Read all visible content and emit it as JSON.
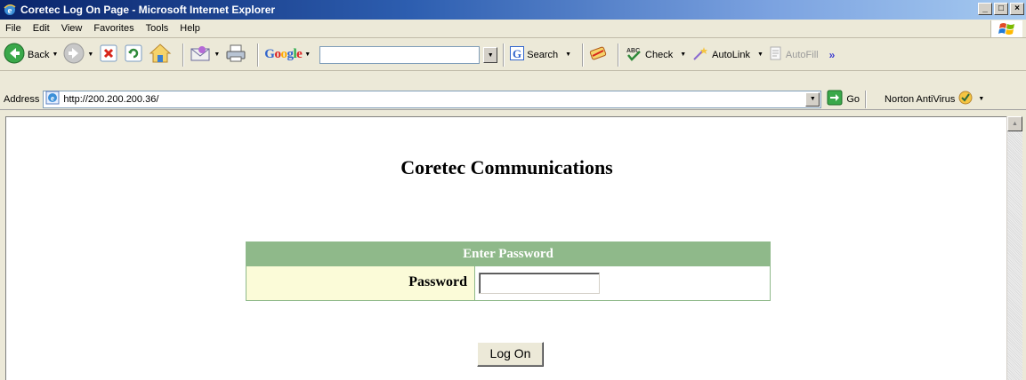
{
  "window": {
    "title": "Coretec Log On Page - Microsoft Internet Explorer",
    "controls": [
      "_",
      "□",
      "×"
    ]
  },
  "menu": {
    "items": [
      "File",
      "Edit",
      "View",
      "Favorites",
      "Tools",
      "Help"
    ]
  },
  "toolbar": {
    "back_label": "Back",
    "google_label": "Google",
    "search_label": "Search",
    "check_label": "Check",
    "autolink_label": "AutoLink",
    "autofill_label": "AutoFill",
    "more_label": "»"
  },
  "address": {
    "label": "Address",
    "url": "http://200.200.200.36/",
    "go_label": "Go",
    "norton_label": "Norton AntiVirus"
  },
  "page": {
    "heading": "Coretec Communications",
    "form_header": "Enter Password",
    "password_label": "Password",
    "password_value": "",
    "logon_label": "Log On"
  },
  "colors": {
    "table_header": "#8fb98a",
    "label_cell": "#fbfbd8",
    "title_bar": "#0a246a"
  }
}
